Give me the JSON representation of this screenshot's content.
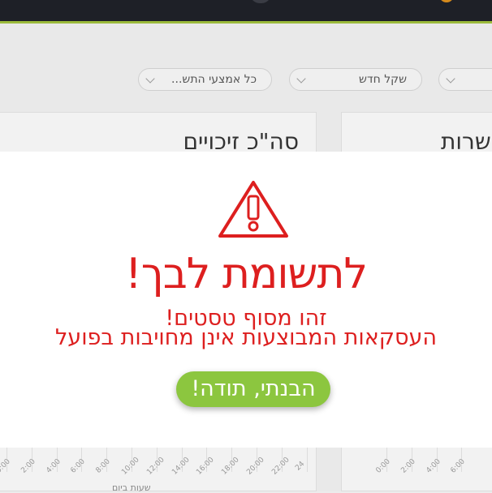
{
  "filters": {
    "device_select": "כל אמצעי התש...",
    "currency_select": "שקל חדש"
  },
  "panels": {
    "credits_title": "סה\"כ זיכויים",
    "approvals_title": "אשרות"
  },
  "chart_axis": {
    "left_ticks": [
      "0:00",
      "2:00",
      "4:00",
      "6:00",
      "8:00",
      "10:00",
      "12:00",
      "14:00",
      "16:00",
      "18:00",
      "20:00",
      "22:00",
      "24"
    ],
    "right_ticks": [
      "0:00",
      "2:00",
      "4:00",
      "6:00"
    ],
    "x_title": "שעות ביום"
  },
  "modal": {
    "title": "לתשומת לבך!",
    "line1": "זהו מסוף טסטים!",
    "line2": "העסקאות המבוצעות אינן מחויבות בפועל",
    "button_label": "הבנתי, תודה!"
  },
  "colors": {
    "accent_green": "#8cc63f",
    "alert_red": "#dd1f1f",
    "topbar": "#1e2027"
  }
}
